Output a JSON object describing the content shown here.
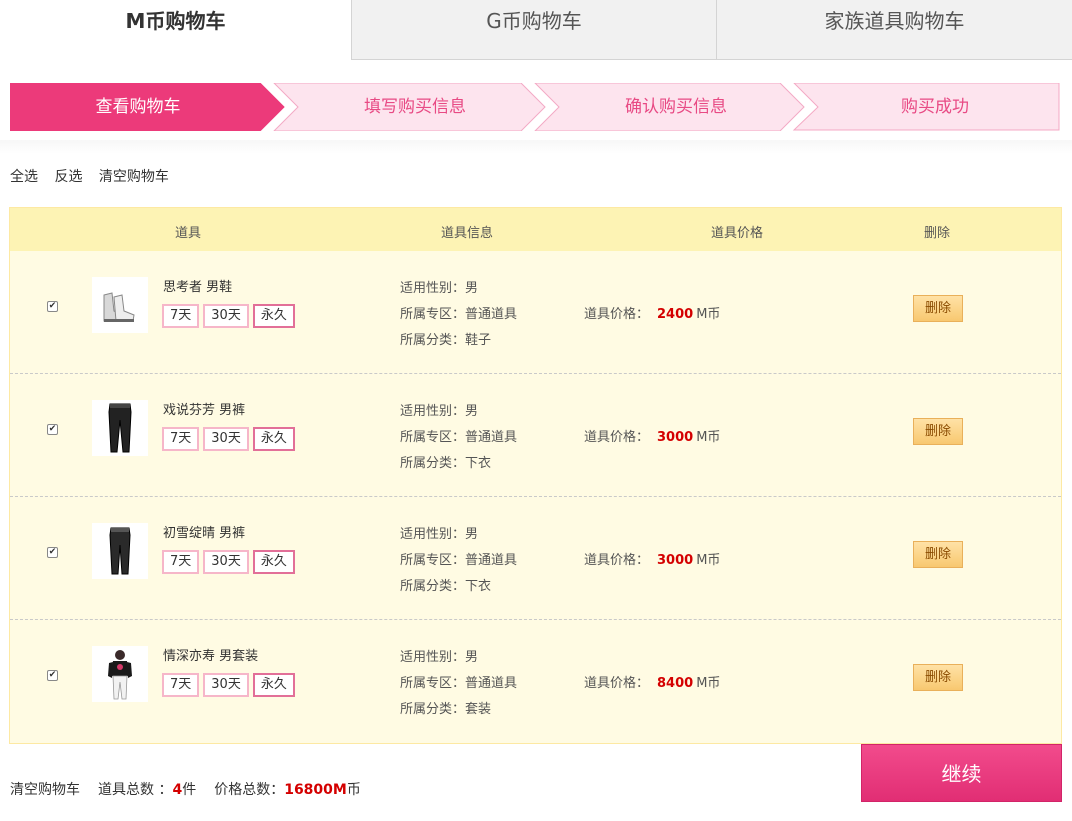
{
  "tabs": [
    {
      "label": "M币购物车"
    },
    {
      "label": "G币购物车"
    },
    {
      "label": "家族道具购物车"
    }
  ],
  "steps": [
    {
      "label": "查看购物车"
    },
    {
      "label": "填写购买信息"
    },
    {
      "label": "确认购买信息"
    },
    {
      "label": "购买成功"
    }
  ],
  "colors": {
    "accent": "#ec3a7a",
    "step_inactive": "#fde4ee",
    "price": "#d40000",
    "table_bg": "#fffbe3"
  },
  "actions": {
    "select_all": "全选",
    "invert": "反选",
    "clear": "清空购物车"
  },
  "table": {
    "headers": {
      "item": "道具",
      "info": "道具信息",
      "price": "道具价格",
      "delete": "删除"
    },
    "info_labels": {
      "gender": "适用性别：",
      "zone": "所属专区：",
      "category": "所属分类："
    },
    "price_label": "道具价格：",
    "currency": "M币",
    "delete_label": "删除",
    "durations": [
      "7天",
      "30天",
      "永久"
    ],
    "rows": [
      {
        "name": "思考者 男鞋",
        "gender": "男",
        "zone": "普通道具",
        "category": "鞋子",
        "price": "2400",
        "icon": "shoes-icon"
      },
      {
        "name": "戏说芬芳 男裤",
        "gender": "男",
        "zone": "普通道具",
        "category": "下衣",
        "price": "3000",
        "icon": "pants-icon"
      },
      {
        "name": "初雪绽晴 男裤",
        "gender": "男",
        "zone": "普通道具",
        "category": "下衣",
        "price": "3000",
        "icon": "pants-icon"
      },
      {
        "name": "情深亦寿 男套装",
        "gender": "男",
        "zone": "普通道具",
        "category": "套装",
        "price": "8400",
        "icon": "outfit-icon"
      }
    ]
  },
  "footer": {
    "clear": "清空购物车",
    "count_label": "道具总数 ：",
    "count": "4",
    "count_unit": "件",
    "total_label": "价格总数：",
    "total": "16800M",
    "total_unit": "币",
    "continue": "继续"
  }
}
